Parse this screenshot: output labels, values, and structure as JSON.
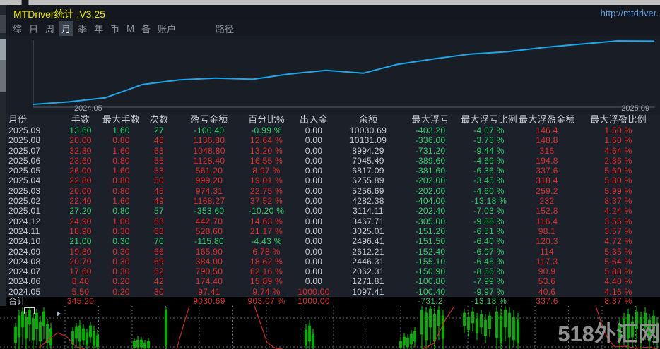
{
  "window": {
    "title": "MTDriver统计 ,V3.25",
    "url": "http://mtdriver."
  },
  "menu": {
    "items": [
      "综",
      "日",
      "周",
      "月",
      "季",
      "年",
      "币",
      "M",
      "备",
      "账户"
    ],
    "active_index": 3,
    "path_item": "路径"
  },
  "watermark": "518外汇网",
  "colors": {
    "profit_red": "#e22e2e",
    "loss_green": "#2bd06c",
    "neutral_text": "#c3c9d4",
    "equity_line": "#1ea6e8",
    "candle_green": "#00dc00",
    "indicator_red": "#cc2626",
    "title_yellow": "#e8e800",
    "url_blue": "#5d9fe0"
  },
  "chart_data": [
    {
      "type": "line",
      "title": "equity curve (account balance over time, log scale)",
      "legend": "none",
      "grid": "off",
      "x_axis": {
        "start_label": "2024.05",
        "end_label": "2025.09"
      },
      "x_days": [
        0,
        30,
        60,
        91,
        122,
        152,
        183,
        213,
        244,
        275,
        303,
        334,
        364,
        395,
        425,
        456,
        487,
        517
      ],
      "series": [
        {
          "name": "balance",
          "values": [
            1000,
            1097.41,
            1271.81,
            2062.31,
            2446.31,
            2612.21,
            2496.41,
            3025.01,
            3467.71,
            3114.11,
            4282.38,
            5256.69,
            6255.89,
            6817.09,
            7945.49,
            8994.29,
            10131.09,
            10030.69
          ]
        }
      ],
      "ylim": [
        1000,
        10131.09
      ]
    },
    {
      "type": "candlestick",
      "title": "background MT4 price chart (partially visible, decorative)",
      "grid": "dashed",
      "candles": [
        [
          22,
          24,
          61,
          30,
          52
        ],
        [
          27,
          6,
          61,
          14,
          44
        ],
        [
          32,
          2,
          55,
          8,
          30
        ],
        [
          37,
          8,
          61,
          16,
          46
        ],
        [
          42,
          1,
          50,
          6,
          26
        ],
        [
          47,
          10,
          61,
          18,
          48
        ],
        [
          52,
          4,
          56,
          10,
          32
        ],
        [
          57,
          14,
          61,
          22,
          50
        ],
        [
          62,
          2,
          47,
          8,
          28
        ],
        [
          67,
          18,
          61,
          26,
          52
        ],
        [
          72,
          24,
          61,
          32,
          56
        ],
        [
          103,
          30,
          61,
          36,
          54
        ],
        [
          108,
          24,
          58,
          30,
          46
        ],
        [
          113,
          20,
          61,
          28,
          50
        ],
        [
          118,
          26,
          56,
          32,
          48
        ],
        [
          123,
          32,
          61,
          38,
          56
        ],
        [
          128,
          22,
          52,
          28,
          44
        ],
        [
          133,
          28,
          61,
          36,
          56
        ],
        [
          138,
          34,
          61,
          42,
          58
        ],
        [
          190,
          46,
          61,
          50,
          59
        ],
        [
          195,
          42,
          61,
          48,
          58
        ],
        [
          200,
          44,
          61,
          48,
          58
        ],
        [
          205,
          48,
          61,
          52,
          60
        ],
        [
          210,
          45,
          61,
          50,
          59
        ],
        [
          235,
          1,
          61,
          6,
          56
        ],
        [
          433,
          26,
          61,
          34,
          56
        ],
        [
          438,
          20,
          61,
          28,
          50
        ],
        [
          443,
          32,
          61,
          40,
          58
        ],
        [
          567,
          44,
          61,
          50,
          59
        ],
        [
          572,
          38,
          61,
          44,
          56
        ],
        [
          577,
          40,
          61,
          46,
          58
        ],
        [
          582,
          34,
          61,
          40,
          54
        ],
        [
          587,
          30,
          58,
          36,
          50
        ],
        [
          597,
          0,
          61,
          6,
          40
        ],
        [
          603,
          2,
          61,
          10,
          48
        ],
        [
          609,
          0,
          55,
          4,
          30
        ],
        [
          615,
          3,
          61,
          12,
          50
        ],
        [
          621,
          0,
          48,
          6,
          28
        ],
        [
          627,
          5,
          61,
          14,
          46
        ],
        [
          657,
          4,
          38,
          10,
          28
        ],
        [
          663,
          8,
          44,
          16,
          34
        ],
        [
          669,
          2,
          36,
          8,
          24
        ],
        [
          675,
          10,
          48,
          18,
          38
        ],
        [
          681,
          6,
          40,
          12,
          30
        ],
        [
          687,
          12,
          52,
          20,
          42
        ],
        [
          693,
          8,
          44,
          14,
          32
        ],
        [
          703,
          0,
          61,
          8,
          45
        ],
        [
          709,
          4,
          61,
          14,
          52
        ],
        [
          715,
          0,
          50,
          6,
          30
        ],
        [
          721,
          2,
          61,
          10,
          44
        ],
        [
          727,
          6,
          58,
          16,
          48
        ],
        [
          733,
          10,
          61,
          20,
          52
        ],
        [
          877,
          18,
          61,
          26,
          50
        ],
        [
          883,
          10,
          55,
          18,
          40
        ],
        [
          889,
          4,
          61,
          12,
          46
        ],
        [
          895,
          14,
          58,
          22,
          44
        ],
        [
          901,
          0,
          52,
          8,
          32
        ],
        [
          907,
          8,
          61,
          16,
          48
        ],
        [
          913,
          2,
          48,
          10,
          30
        ],
        [
          919,
          12,
          61,
          20,
          50
        ],
        [
          925,
          6,
          56,
          14,
          38
        ],
        [
          930,
          16,
          61,
          24,
          52
        ]
      ],
      "red_line_segments": [
        [
          [
            55,
            60
          ],
          [
            70,
            46
          ],
          [
            82,
            38
          ],
          [
            95,
            44
          ],
          [
            108,
            58
          ],
          [
            120,
            61
          ]
        ],
        [
          [
            250,
            61
          ],
          [
            260,
            26
          ],
          [
            268,
            0
          ]
        ],
        [
          [
            360,
            0
          ],
          [
            369,
            26
          ],
          [
            378,
            52
          ],
          [
            390,
            60
          ],
          [
            400,
            61
          ]
        ],
        [
          [
            598,
            61
          ],
          [
            614,
            53
          ],
          [
            630,
            20
          ],
          [
            643,
            0
          ]
        ],
        [
          [
            843,
            0
          ],
          [
            851,
            24
          ],
          [
            860,
            46
          ],
          [
            870,
            58
          ],
          [
            886,
            57
          ],
          [
            900,
            60
          ],
          [
            918,
            58
          ],
          [
            930,
            61
          ]
        ]
      ]
    }
  ],
  "table": {
    "headers": [
      "月份",
      "手数",
      "最大手数",
      "次数",
      "盈亏金额",
      "百分比%",
      "出入金",
      "余额",
      "最大浮亏",
      "最大浮亏比例",
      "最大浮盈金额",
      "最大浮盈比例"
    ],
    "rows": [
      {
        "cells": [
          "2025.09",
          "13.60",
          "1.60",
          "27",
          "-100.40",
          "-0.99 %",
          "0.00",
          "10030.69",
          "-403.20",
          "-4.07 %",
          "146.4",
          "1.50 %"
        ],
        "trend": "down"
      },
      {
        "cells": [
          "2025.08",
          "20.00",
          "0.80",
          "46",
          "1136.80",
          "12.64 %",
          "0.00",
          "10131.09",
          "-336.00",
          "-3.78 %",
          "148.8",
          "1.60 %"
        ],
        "trend": "up"
      },
      {
        "cells": [
          "2025.07",
          "32.80",
          "1.60",
          "63",
          "1048.80",
          "13.20 %",
          "0.00",
          "8994.29",
          "-731.20",
          "-9.44 %",
          "316",
          "4.64 %"
        ],
        "trend": "up"
      },
      {
        "cells": [
          "2025.06",
          "23.60",
          "0.80",
          "55",
          "1128.40",
          "16.55 %",
          "0.00",
          "7945.49",
          "-389.60",
          "-4.69 %",
          "194.8",
          "2.86 %"
        ],
        "trend": "up"
      },
      {
        "cells": [
          "2025.05",
          "26.00",
          "1.60",
          "53",
          "561.20",
          "8.97 %",
          "0.00",
          "6817.09",
          "-381.60",
          "-6.36 %",
          "337.6",
          "5.69 %"
        ],
        "trend": "up"
      },
      {
        "cells": [
          "2025.04",
          "22.80",
          "0.80",
          "50",
          "999.20",
          "19.01 %",
          "0.00",
          "6255.89",
          "-202.00",
          "-3.45 %",
          "318.4",
          "5.80 %"
        ],
        "trend": "up"
      },
      {
        "cells": [
          "2025.03",
          "20.00",
          "0.80",
          "45",
          "974.31",
          "22.75 %",
          "0.00",
          "5256.69",
          "-202.00",
          "-4.60 %",
          "259.2",
          "5.99 %"
        ],
        "trend": "up"
      },
      {
        "cells": [
          "2025.02",
          "22.40",
          "1.60",
          "49",
          "1168.27",
          "37.52 %",
          "0.00",
          "4282.38",
          "-404.00",
          "-13.18 %",
          "232",
          "8.37 %"
        ],
        "trend": "up"
      },
      {
        "cells": [
          "2025.01",
          "27.20",
          "0.80",
          "57",
          "-353.60",
          "-10.20 %",
          "0.00",
          "3114.11",
          "-202.40",
          "-7.03 %",
          "152.8",
          "4.24 %"
        ],
        "trend": "down"
      },
      {
        "cells": [
          "2024.12",
          "24.90",
          "1.00",
          "63",
          "442.70",
          "14.63 %",
          "0.00",
          "3467.71",
          "-305.00",
          "-9.88 %",
          "116.4",
          "3.55 %"
        ],
        "trend": "up"
      },
      {
        "cells": [
          "2024.11",
          "18.90",
          "0.30",
          "63",
          "528.60",
          "21.17 %",
          "0.00",
          "3025.01",
          "-151.20",
          "-6.51 %",
          "98.1",
          "3.57 %"
        ],
        "trend": "up"
      },
      {
        "cells": [
          "2024.10",
          "21.00",
          "0.30",
          "70",
          "-115.80",
          "-4.43 %",
          "0.00",
          "2496.41",
          "-151.50",
          "-6.40 %",
          "120.3",
          "4.72 %"
        ],
        "trend": "down"
      },
      {
        "cells": [
          "2024.09",
          "19.80",
          "0.30",
          "66",
          "165.90",
          "6.78 %",
          "0.00",
          "2612.21",
          "-152.40",
          "-6.97 %",
          "114",
          "5.35 %"
        ],
        "trend": "up"
      },
      {
        "cells": [
          "2024.08",
          "20.70",
          "0.30",
          "69",
          "384.00",
          "18.62 %",
          "0.00",
          "2446.31",
          "-155.10",
          "-6.46 %",
          "117.3",
          "5.64 %"
        ],
        "trend": "up"
      },
      {
        "cells": [
          "2024.07",
          "17.60",
          "0.30",
          "62",
          "790.50",
          "62.16 %",
          "0.00",
          "2062.31",
          "-150.90",
          "-8.56 %",
          "90.9",
          "5.88 %"
        ],
        "trend": "up"
      },
      {
        "cells": [
          "2024.06",
          "8.40",
          "0.20",
          "42",
          "174.40",
          "15.89 %",
          "0.00",
          "1271.81",
          "-100.80",
          "-7.99 %",
          "53.6",
          "4.40 %"
        ],
        "trend": "up"
      },
      {
        "cells": [
          "2024.05",
          "5.50",
          "0.20",
          "30",
          "97.41",
          "9.74 %",
          "1000.00",
          "1097.41",
          "-100.40",
          "-9.97 %",
          "40.6",
          "4.16 %"
        ],
        "trend": "up"
      }
    ],
    "total": {
      "cells": [
        "合计",
        "345.20",
        "",
        "",
        "9030.69",
        "903.07 %",
        "1000.00",
        "",
        "-731.2",
        "-13.18 %",
        "337.6",
        "8.37 %"
      ],
      "trend": "up"
    }
  }
}
